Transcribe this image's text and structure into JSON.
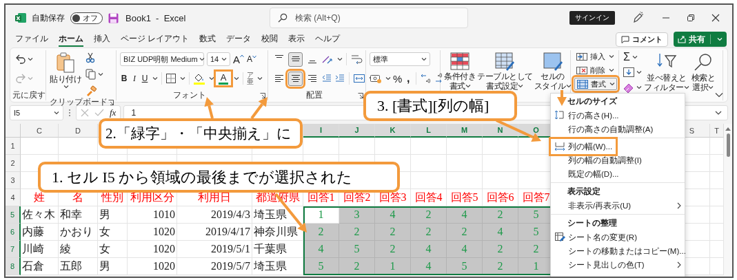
{
  "title_bar": {
    "autosave_label": "自動保存",
    "autosave": {
      "label": "オフ",
      "on": false
    },
    "title": "Book1  -  Excel",
    "search": {
      "placeholder": "検索 (Alt+Q)"
    },
    "sign_in": "サインイン"
  },
  "menu_tabs": [
    {
      "label": "ファイル",
      "selected": false
    },
    {
      "label": "ホーム",
      "selected": true
    },
    {
      "label": "挿入",
      "selected": false
    },
    {
      "label": "ページ レイアウト",
      "selected": false
    },
    {
      "label": "数式",
      "selected": false
    },
    {
      "label": "データ",
      "selected": false
    },
    {
      "label": "校閲",
      "selected": false
    },
    {
      "label": "表示",
      "selected": false
    },
    {
      "label": "ヘルプ",
      "selected": false
    }
  ],
  "comment_button": "コメント",
  "share_button": "共有",
  "ribbon": {
    "undo": {
      "label": "元に戻す"
    },
    "clipboard": {
      "paste": "貼り付け",
      "label": "クリップボード"
    },
    "font": {
      "name": "BIZ UDP明朝 Medium",
      "size": "14",
      "grow": "A",
      "shrink": "A",
      "styles": [
        {
          "kind": "bold",
          "text": "B"
        },
        {
          "kind": "italic",
          "text": "I"
        },
        {
          "kind": "underline",
          "text": "U"
        }
      ],
      "font_color": {
        "text": "A",
        "highlighted": true
      },
      "phonetic": {
        "kana": "ア",
        "kanji": "亜"
      },
      "label": "フォント"
    },
    "alignment": {
      "vertical": [
        {
          "kind": "top",
          "selected": false
        },
        {
          "kind": "middle",
          "selected": true
        },
        {
          "kind": "bottom",
          "selected": false
        }
      ],
      "horizontal": [
        {
          "kind": "left",
          "selected": false,
          "highlighted": false
        },
        {
          "kind": "center",
          "selected": true,
          "highlighted": true
        },
        {
          "kind": "right",
          "selected": false,
          "highlighted": false
        }
      ],
      "label": "配置"
    },
    "number": {
      "format": "標準",
      "percent": "%",
      "comma": ","
    },
    "styles": [
      {
        "kind": "conditional",
        "lines": [
          "条件付き",
          "書式"
        ]
      },
      {
        "kind": "table",
        "lines": [
          "テーブルとして",
          "書式設定"
        ]
      },
      {
        "kind": "cell",
        "lines": [
          "セルの",
          "スタイル"
        ]
      }
    ],
    "cells": [
      {
        "kind": "insert",
        "label": "挿入",
        "highlighted": false
      },
      {
        "kind": "delete",
        "label": "削除",
        "highlighted": false
      },
      {
        "kind": "format",
        "label": "書式",
        "highlighted": true
      }
    ],
    "editing": {
      "sum": "Σ",
      "sort": [
        "並べ替えと",
        "フィルター"
      ],
      "find": [
        "検索と",
        "選択"
      ]
    }
  },
  "formula_bar": {
    "name_box": "I5",
    "fx": "fx",
    "formula": "1"
  },
  "sheet": {
    "columns": [
      {
        "label": "C",
        "selected": false
      },
      {
        "label": "D",
        "selected": false
      },
      {
        "selected": false
      },
      {
        "selected": false
      },
      {
        "selected": false
      },
      {
        "selected": false
      },
      {
        "label": "I",
        "selected": true
      },
      {
        "label": "J",
        "selected": true
      },
      {
        "label": "K",
        "selected": true
      },
      {
        "label": "L",
        "selected": true
      },
      {
        "label": "M",
        "selected": true
      },
      {
        "label": "N",
        "selected": true
      },
      {
        "label": "O",
        "selected": true
      },
      {},
      {},
      {},
      {
        "label": "S",
        "selected": false
      },
      {
        "label": "T",
        "selected": false
      }
    ],
    "rows": [
      {
        "number": "1",
        "selected": false,
        "cells": []
      },
      {
        "number": "2",
        "selected": false,
        "cells": []
      },
      {
        "number": "3",
        "selected": false,
        "cells": []
      },
      {
        "number": "4",
        "selected": false,
        "cells": [
          {
            "text": "姓",
            "kind": "heading"
          },
          {
            "text": "名",
            "kind": "heading"
          },
          {
            "text": "性別",
            "kind": "heading"
          },
          {
            "text": "利用区分",
            "kind": "heading"
          },
          {
            "text": "利用日",
            "kind": "heading"
          },
          {
            "text": "都道府県",
            "kind": "heading"
          },
          {
            "text": "回答1",
            "kind": "heading"
          },
          {
            "text": "回答2",
            "kind": "heading"
          },
          {
            "text": "回答3",
            "kind": "heading"
          },
          {
            "text": "回答4",
            "kind": "heading"
          },
          {
            "text": "回答5",
            "kind": "heading"
          },
          {
            "text": "回答6",
            "kind": "heading"
          },
          {
            "text": "回答7",
            "kind": "heading"
          }
        ]
      },
      {
        "number": "5",
        "selected": true,
        "cells": [
          {
            "text": "佐々木",
            "kind": "text"
          },
          {
            "text": "和幸",
            "kind": "text"
          },
          {
            "text": "男",
            "kind": "text"
          },
          {
            "text": "1010",
            "kind": "number"
          },
          {
            "text": "2019/4/3",
            "kind": "number"
          },
          {
            "text": "埼玉県",
            "kind": "text"
          },
          {
            "text": "1",
            "kind": "answer",
            "active": true
          },
          {
            "text": "3",
            "kind": "answer",
            "active": false
          },
          {
            "text": "4",
            "kind": "answer",
            "active": false
          },
          {
            "text": "2",
            "kind": "answer",
            "active": false
          },
          {
            "text": "4",
            "kind": "answer",
            "active": false
          },
          {
            "text": "2",
            "kind": "answer",
            "active": false
          },
          {
            "text": "5",
            "kind": "answer",
            "active": false
          }
        ]
      },
      {
        "number": "6",
        "selected": true,
        "cells": [
          {
            "text": "内藤",
            "kind": "text"
          },
          {
            "text": "かおり",
            "kind": "text"
          },
          {
            "text": "女",
            "kind": "text"
          },
          {
            "text": "1020",
            "kind": "number"
          },
          {
            "text": "2019/4/17",
            "kind": "number"
          },
          {
            "text": "神奈川県",
            "kind": "text"
          },
          {
            "text": "2",
            "kind": "answer",
            "active": false
          },
          {
            "text": "2",
            "kind": "answer",
            "active": false
          },
          {
            "text": "2",
            "kind": "answer",
            "active": false
          },
          {
            "text": "2",
            "kind": "answer",
            "active": false
          },
          {
            "text": "2",
            "kind": "answer",
            "active": false
          },
          {
            "text": "4",
            "kind": "answer",
            "active": false
          },
          {
            "text": "5",
            "kind": "answer",
            "active": false
          }
        ]
      },
      {
        "number": "7",
        "selected": true,
        "cells": [
          {
            "text": "川崎",
            "kind": "text"
          },
          {
            "text": "綾",
            "kind": "text"
          },
          {
            "text": "女",
            "kind": "text"
          },
          {
            "text": "1020",
            "kind": "number"
          },
          {
            "text": "2019/5/1",
            "kind": "number"
          },
          {
            "text": "千葉県",
            "kind": "text"
          },
          {
            "text": "4",
            "kind": "answer",
            "active": false
          },
          {
            "text": "5",
            "kind": "answer",
            "active": false
          },
          {
            "text": "2",
            "kind": "answer",
            "active": false
          },
          {
            "text": "4",
            "kind": "answer",
            "active": false
          },
          {
            "text": "4",
            "kind": "answer",
            "active": false
          },
          {
            "text": "2",
            "kind": "answer",
            "active": false
          },
          {
            "text": "2",
            "kind": "answer",
            "active": false
          }
        ]
      },
      {
        "number": "8",
        "selected": true,
        "cells": [
          {
            "text": "石倉",
            "kind": "text"
          },
          {
            "text": "五郎",
            "kind": "text"
          },
          {
            "text": "男",
            "kind": "text"
          },
          {
            "text": "1020",
            "kind": "number"
          },
          {
            "text": "2019/5/7",
            "kind": "number"
          },
          {
            "text": "埼玉県",
            "kind": "text"
          },
          {
            "text": "5",
            "kind": "answer",
            "active": false
          },
          {
            "text": "2",
            "kind": "answer",
            "active": false
          },
          {
            "text": "1",
            "kind": "answer",
            "active": false
          },
          {
            "text": "4",
            "kind": "answer",
            "active": false
          },
          {
            "text": "5",
            "kind": "answer",
            "active": false
          },
          {
            "text": "2",
            "kind": "answer",
            "active": false
          },
          {
            "text": "1",
            "kind": "answer",
            "active": false
          }
        ]
      }
    ]
  },
  "format_menu": [
    {
      "kind": "heading",
      "text": "セルのサイズ"
    },
    {
      "kind": "item",
      "text": "行の高さ(H)...",
      "highlighted": false
    },
    {
      "kind": "item",
      "text": "行の高さの自動調整(A)",
      "highlighted": false
    },
    {
      "kind": "divider"
    },
    {
      "kind": "item",
      "text": "列の幅(W)...",
      "highlighted": true
    },
    {
      "kind": "item",
      "text": "列の幅の自動調整(I)",
      "highlighted": false
    },
    {
      "kind": "item",
      "text": "既定の幅(D)...",
      "highlighted": false
    },
    {
      "kind": "divider"
    },
    {
      "kind": "heading",
      "text": "表示設定"
    },
    {
      "kind": "item",
      "text": "非表示/再表示(U)",
      "submenu": true,
      "highlighted": false
    },
    {
      "kind": "divider"
    },
    {
      "kind": "heading",
      "text": "シートの整理"
    },
    {
      "kind": "item",
      "text": "シート名の変更(R)",
      "highlighted": false
    },
    {
      "kind": "item",
      "text": "シートの移動またはコピー(M)...",
      "highlighted": false
    },
    {
      "kind": "item",
      "text": "シート見出しの色(T)",
      "submenu": true,
      "highlighted": false
    }
  ],
  "callouts": [
    "3. [書式][列の幅]",
    "2.「緑字」・「中央揃え」に",
    "1. セル I5 から領域の最後までが選択された"
  ]
}
